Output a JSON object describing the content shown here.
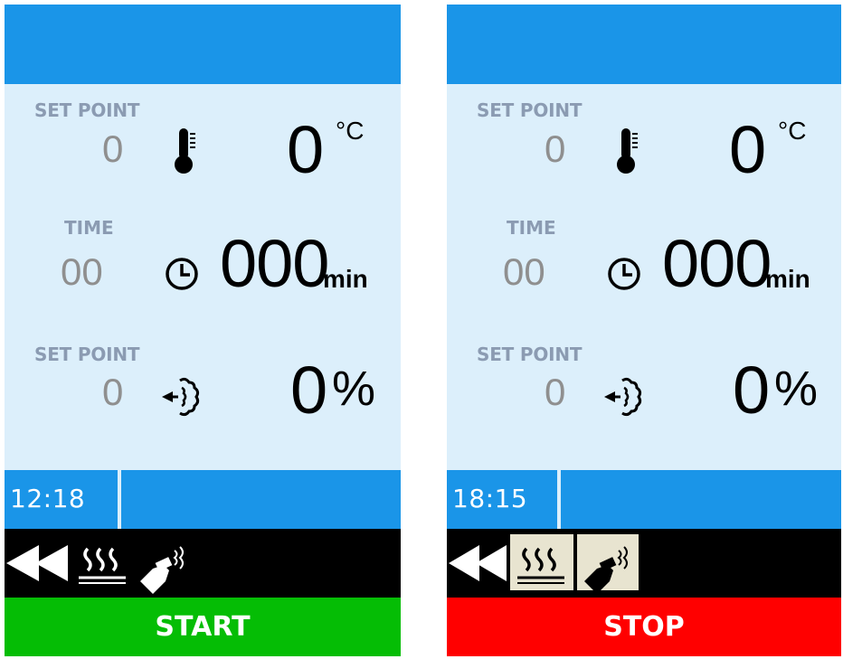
{
  "panels": [
    {
      "temperature": {
        "setpoint_label": "SET POINT",
        "setpoint_value": "0",
        "current_value": "0",
        "unit": "°C"
      },
      "time": {
        "label": "TIME",
        "setpoint_value": "00",
        "current_value": "000",
        "unit": "min"
      },
      "humidity": {
        "setpoint_label": "SET POINT",
        "setpoint_value": "0",
        "current_value": "0",
        "unit": "%"
      },
      "clock": "12:18",
      "toolbar": {
        "icons": [
          "rewind-icon",
          "heat-icon",
          "steam-nozzle-icon"
        ],
        "active": false
      },
      "action_label": "START",
      "action_color": "#05bd05"
    },
    {
      "temperature": {
        "setpoint_label": "SET POINT",
        "setpoint_value": "0",
        "current_value": "0",
        "unit": "°C"
      },
      "time": {
        "label": "TIME",
        "setpoint_value": "00",
        "current_value": "000",
        "unit": "min"
      },
      "humidity": {
        "setpoint_label": "SET POINT",
        "setpoint_value": "0",
        "current_value": "0",
        "unit": "%"
      },
      "clock": "18:15",
      "toolbar": {
        "icons": [
          "rewind-icon",
          "heat-icon",
          "steam-nozzle-icon"
        ],
        "active": true
      },
      "action_label": "STOP",
      "action_color": "#ff0000"
    }
  ],
  "colors": {
    "header_blue": "#1a95e8",
    "background": "#dceffb",
    "label_gray": "#8b9bb2",
    "setpoint_gray": "#8f8f8f"
  }
}
